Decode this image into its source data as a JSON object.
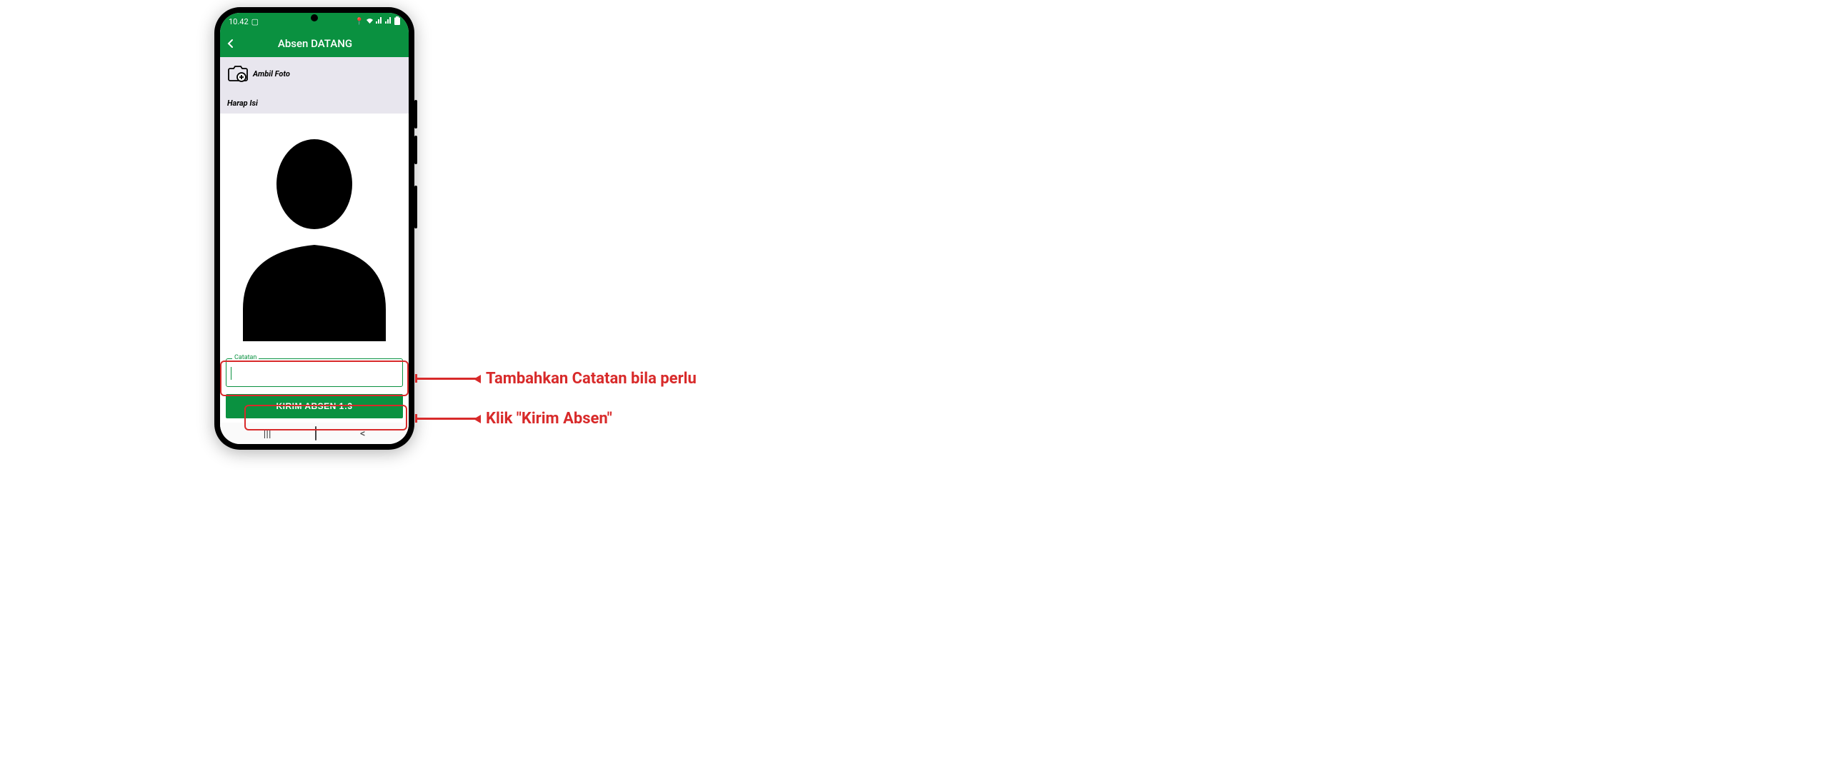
{
  "status": {
    "time": "10.42",
    "icons_right": "📍 📶 📶 🔋"
  },
  "app_bar": {
    "title": "Absen DATANG"
  },
  "photo_section": {
    "take_photo_label": "Ambil Foto",
    "hint": "Harap Isi"
  },
  "input": {
    "legend": "Catatan",
    "value": ""
  },
  "submit": {
    "label": "KIRIM ABSEN 1:3"
  },
  "nav": {
    "recent": "|||",
    "back": "<"
  },
  "annotations": {
    "a1": "Tambahkan Catatan bila perlu",
    "a2": "Klik \"Kirim Absen\""
  }
}
